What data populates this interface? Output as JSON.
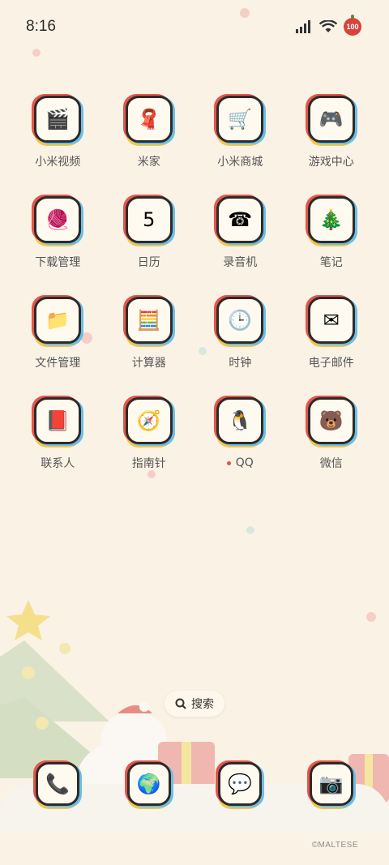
{
  "status": {
    "time": "8:16",
    "battery": "100"
  },
  "apps": [
    {
      "label": "小米视频",
      "icon": "video-icon",
      "glyph": "🎬"
    },
    {
      "label": "米家",
      "icon": "home-icon",
      "glyph": "🧣"
    },
    {
      "label": "小米商城",
      "icon": "cart-icon",
      "glyph": "🛒"
    },
    {
      "label": "游戏中心",
      "icon": "gamepad-icon",
      "glyph": "🎮"
    },
    {
      "label": "下载管理",
      "icon": "download-icon",
      "glyph": "🧶"
    },
    {
      "label": "日历",
      "icon": "calendar-icon",
      "glyph": "5"
    },
    {
      "label": "录音机",
      "icon": "recorder-icon",
      "glyph": "☎"
    },
    {
      "label": "笔记",
      "icon": "notes-icon",
      "glyph": "🎄"
    },
    {
      "label": "文件管理",
      "icon": "folder-icon",
      "glyph": "📁"
    },
    {
      "label": "计算器",
      "icon": "calculator-icon",
      "glyph": "🧮"
    },
    {
      "label": "时钟",
      "icon": "clock-icon",
      "glyph": "🕒"
    },
    {
      "label": "电子邮件",
      "icon": "mail-icon",
      "glyph": "✉"
    },
    {
      "label": "联系人",
      "icon": "contacts-icon",
      "glyph": "📕"
    },
    {
      "label": "指南针",
      "icon": "compass-icon",
      "glyph": "🧭"
    },
    {
      "label": "QQ",
      "icon": "qq-icon",
      "glyph": "🐧",
      "badge": true
    },
    {
      "label": "微信",
      "icon": "wechat-icon",
      "glyph": "🐻"
    }
  ],
  "search": {
    "label": "搜索"
  },
  "dock": [
    {
      "icon": "phone-icon",
      "glyph": "📞"
    },
    {
      "icon": "browser-icon",
      "glyph": "🌍"
    },
    {
      "icon": "messages-icon",
      "glyph": "💬"
    },
    {
      "icon": "camera-icon",
      "glyph": "📷"
    }
  ],
  "watermark": "©MALTESE",
  "colors": {
    "background": "#fbf2e6",
    "accent_red": "#e6554a",
    "accent_blue": "#6bbfe6",
    "accent_yellow": "#f2c64a"
  }
}
